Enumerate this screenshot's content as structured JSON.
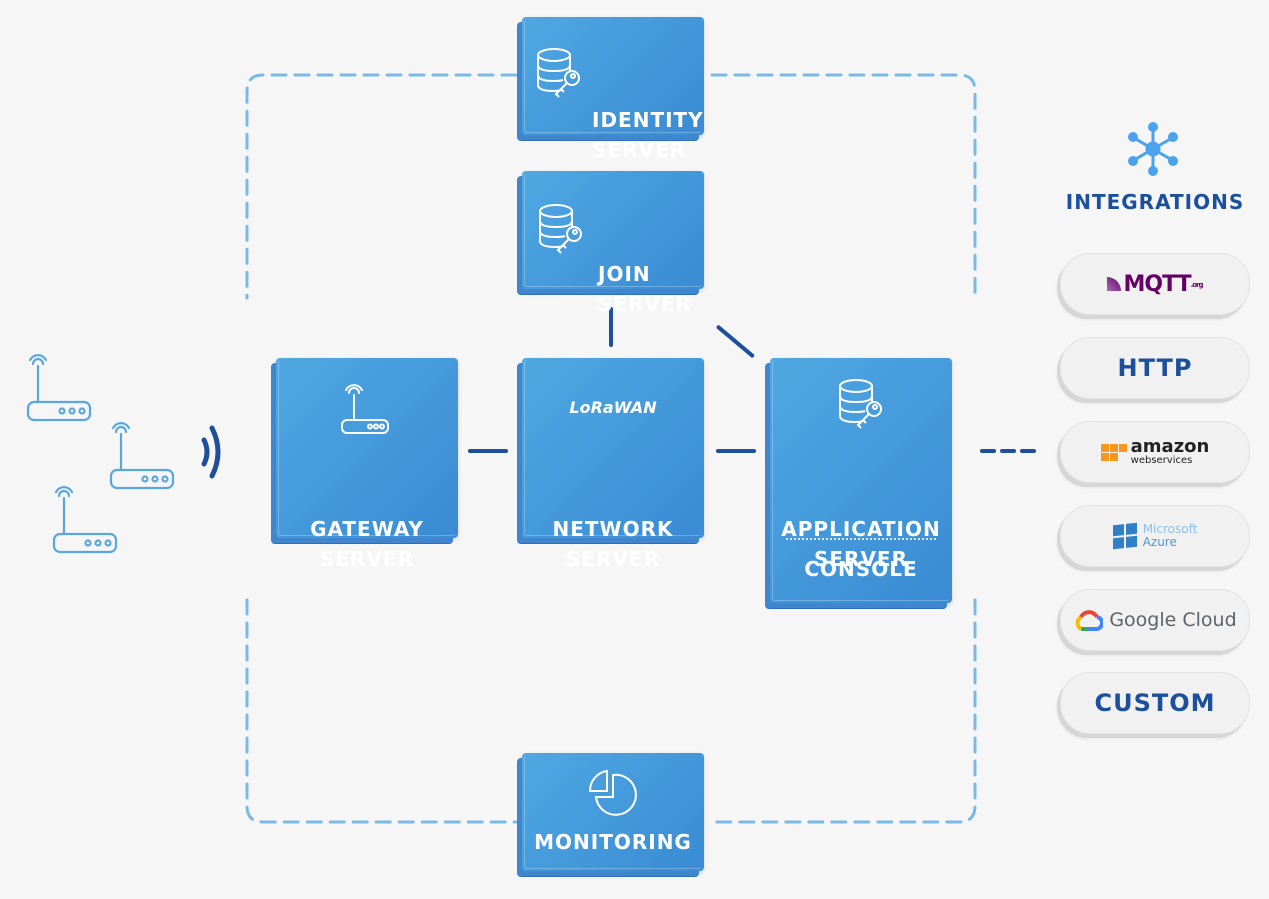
{
  "servers": {
    "identity": {
      "line1": "IDENTITY",
      "line2": "SERVER",
      "icon": "database-key-icon"
    },
    "join": {
      "line1": "JOIN",
      "line2": "SERVER",
      "icon": "database-key-icon"
    },
    "gateway": {
      "line1": "GATEWAY",
      "line2": "SERVER",
      "icon": "router-icon"
    },
    "network": {
      "line1": "NETWORK",
      "line2": "SERVER",
      "logo": "LoRaWAN",
      "icon": "lorawan-logo"
    },
    "application": {
      "line1": "APPLICATION",
      "line2": "SERVER",
      "sub": "CONSOLE",
      "icon": "database-key-icon"
    },
    "monitoring": {
      "line1": "MONITORING",
      "icon": "pie-chart-icon"
    }
  },
  "devices": {
    "count": 3,
    "icon": "router-icon",
    "signal_icon": "signal-waves-icon"
  },
  "integrations": {
    "title": "INTEGRATIONS",
    "icon": "hub-network-icon",
    "items": [
      {
        "name": "MQTT",
        "logo_text": "MQTT",
        "logo_sub": ".org",
        "color": "#660066"
      },
      {
        "name": "HTTP",
        "logo_text": "HTTP",
        "color": "#1c4f9c"
      },
      {
        "name": "Amazon Web Services",
        "logo_text": "amazon",
        "logo_sub": "webservices",
        "color": "#f7981d"
      },
      {
        "name": "Microsoft Azure",
        "logo_text": "Microsoft",
        "logo_sub": "Azure",
        "color": "#2f80c8"
      },
      {
        "name": "Google Cloud",
        "logo_text": "Google Cloud",
        "color": "#5f6368"
      },
      {
        "name": "CUSTOM",
        "logo_text": "CUSTOM",
        "color": "#1c4f9c"
      }
    ]
  },
  "colors": {
    "box_light": "#4fa8e2",
    "box_dark": "#3a8bd3",
    "connector": "#1d4f9a",
    "dashed_frame": "#7ab9e4",
    "background": "#f6f6f6"
  }
}
